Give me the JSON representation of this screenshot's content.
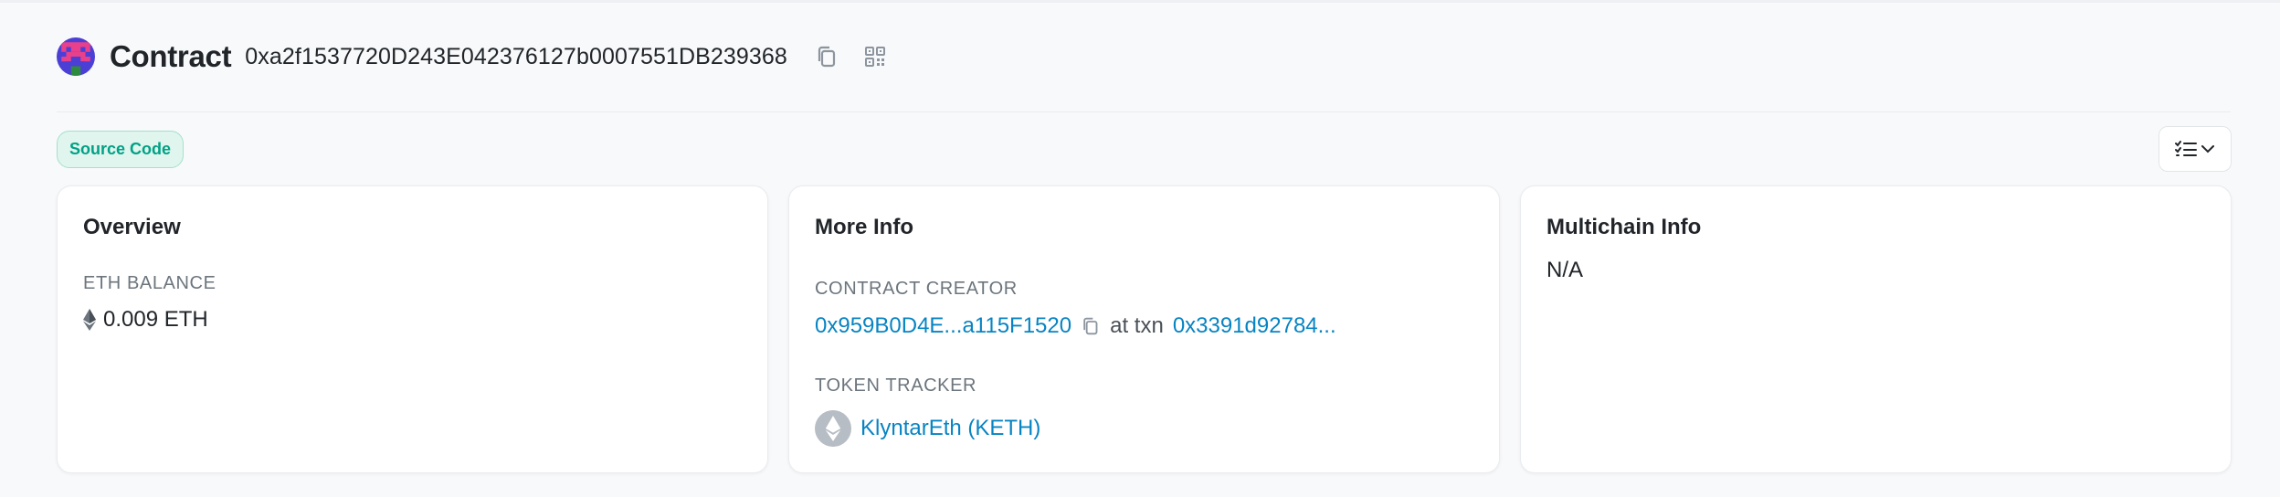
{
  "header": {
    "title": "Contract",
    "address": "0xa2f1537720D243E042376127b0007551DB239368"
  },
  "badge": {
    "source_code": "Source Code"
  },
  "overview": {
    "title": "Overview",
    "eth_balance_label": "ETH BALANCE",
    "eth_balance_value": "0.009 ETH"
  },
  "more_info": {
    "title": "More Info",
    "creator_label": "CONTRACT CREATOR",
    "creator_address": "0x959B0D4E...a115F1520",
    "at_txn_text": "at txn",
    "txn_hash": "0x3391d92784...",
    "token_tracker_label": "TOKEN TRACKER",
    "token_name": "KlyntarEth (KETH)"
  },
  "multichain": {
    "title": "Multichain Info",
    "value": "N/A"
  },
  "icons": {
    "avatar": "blockie-avatar-icon",
    "copy": "copy-icon",
    "qr": "qr-code-icon",
    "list": "checklist-icon",
    "chevron": "chevron-down-icon",
    "eth": "ethereum-icon"
  },
  "colors": {
    "link": "#0784c3",
    "badge_text": "#00a186",
    "badge_bg": "#dff5ee"
  }
}
